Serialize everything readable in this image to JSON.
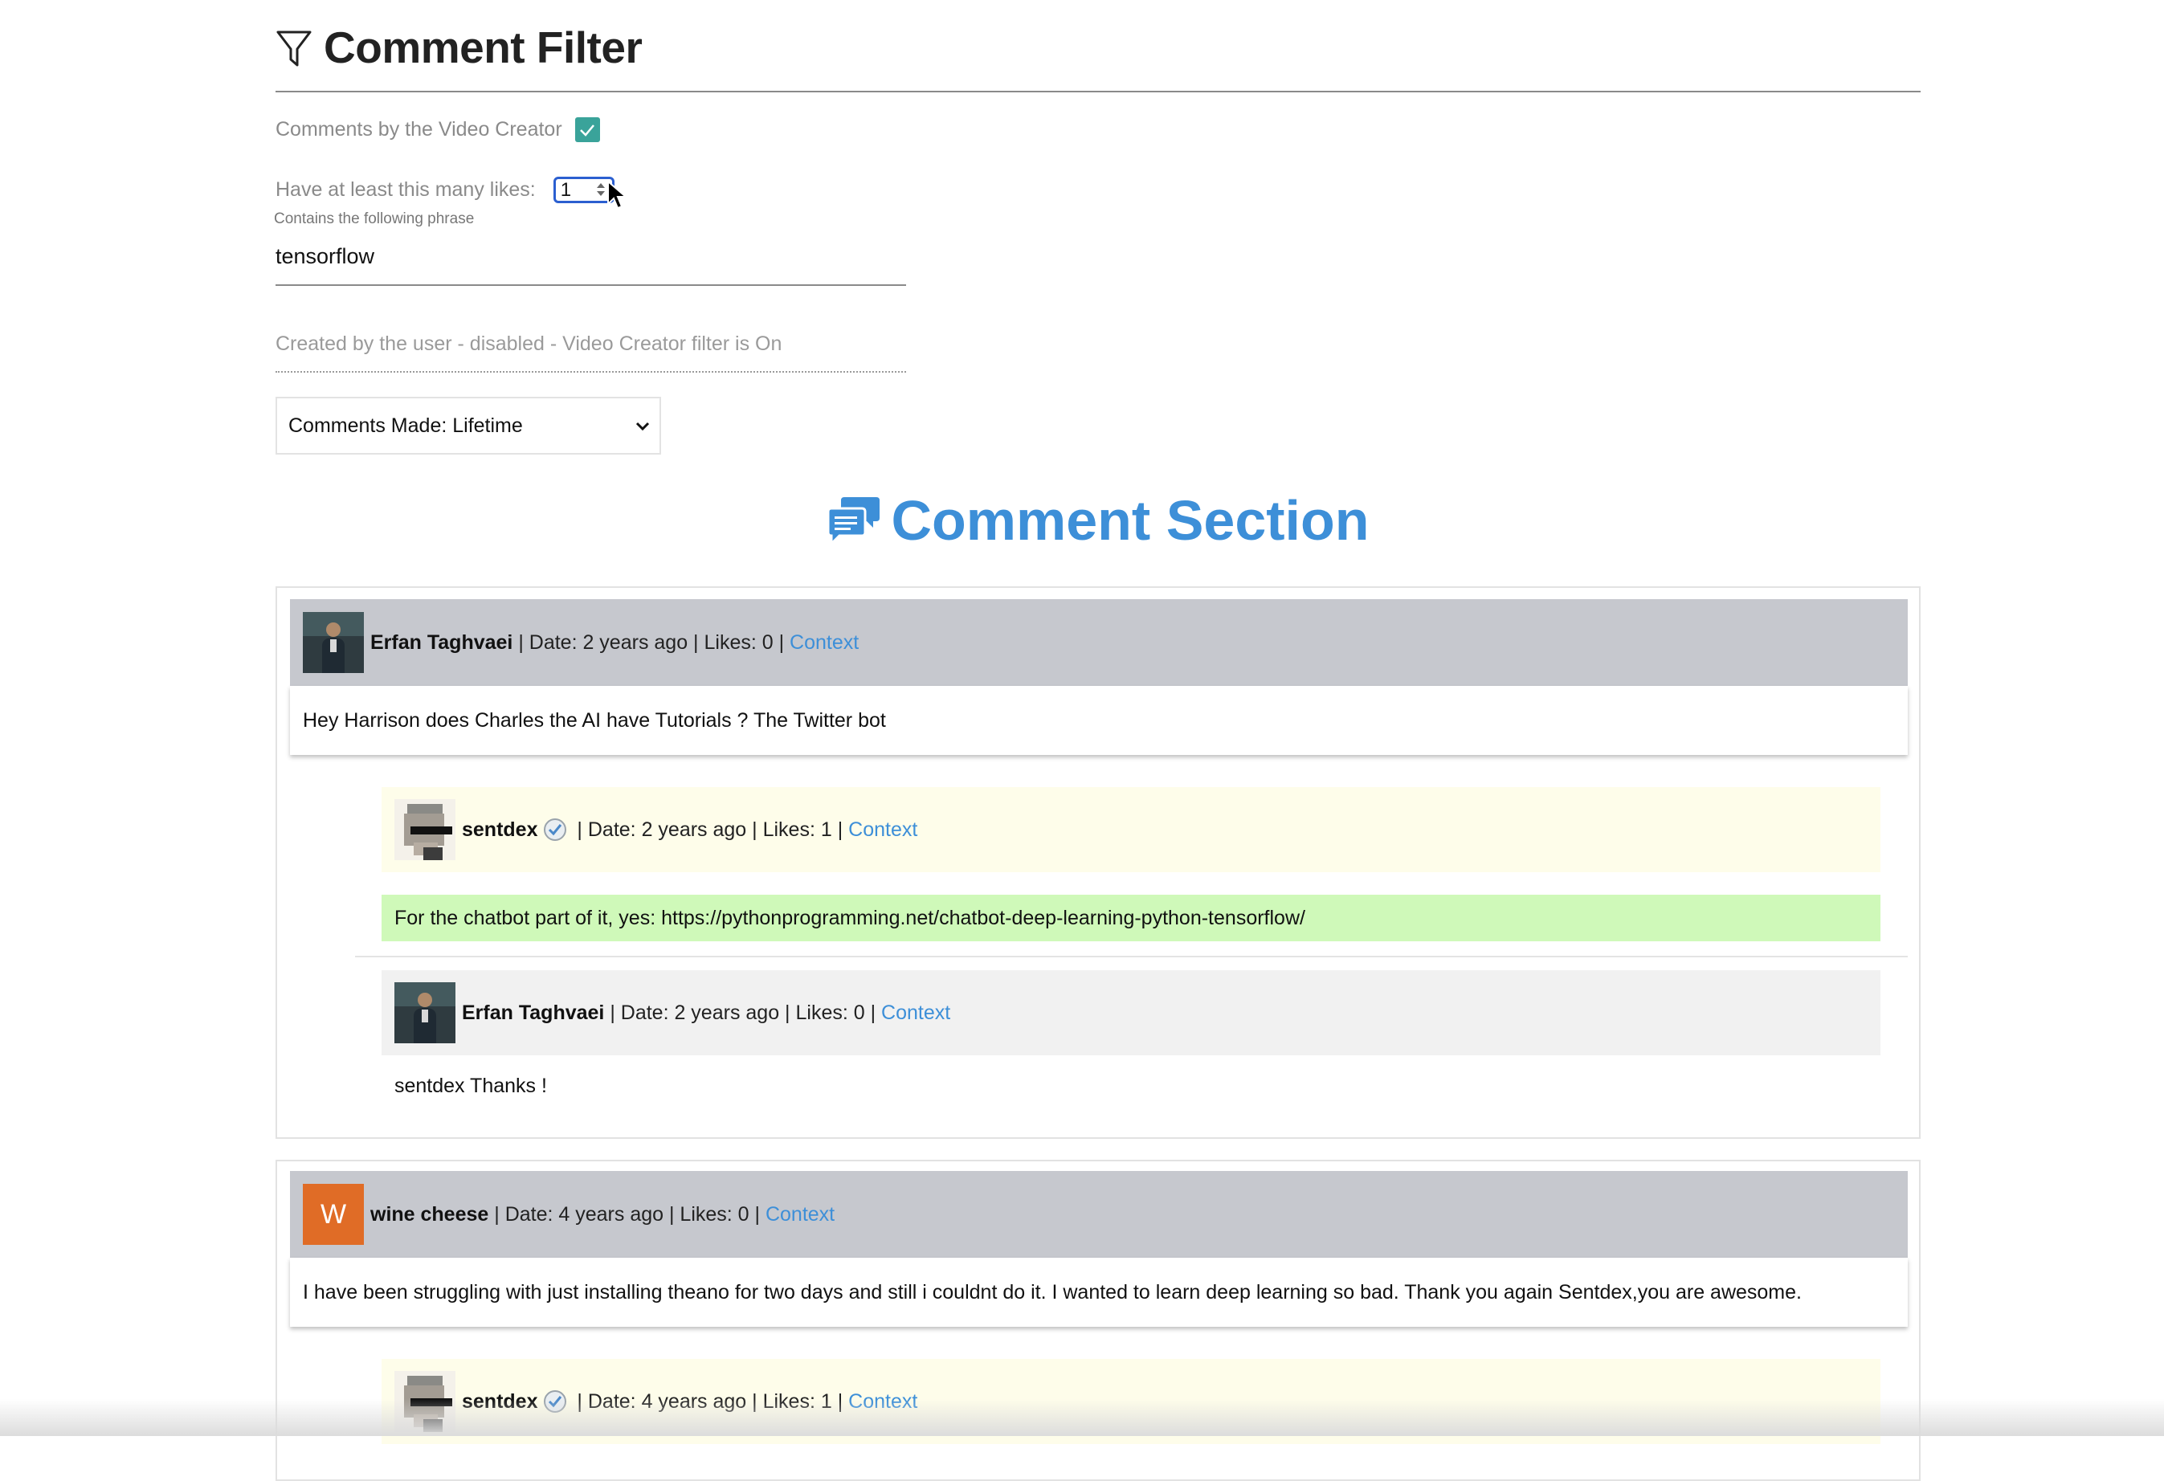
{
  "filter": {
    "title": "Comment Filter",
    "creator_label": "Comments by the Video Creator",
    "creator_checked": true,
    "likes_label": "Have at least this many likes:",
    "likes_value": "1",
    "phrase_caption": "Contains the following phrase",
    "phrase_value": "tensorflow",
    "user_placeholder": "Created by the user - disabled - Video Creator filter is On",
    "period_selected": "Comments Made: Lifetime"
  },
  "comment_section": {
    "title": "Comment Section"
  },
  "threads": [
    {
      "top": {
        "author": "Erfan Taghvaei",
        "meta": " | Date: 2 years ago | Likes: 0 | ",
        "context": "Context",
        "text": "Hey Harrison does Charles the AI have Tutorials ? The Twitter bot"
      },
      "replies": [
        {
          "author": "sentdex",
          "verified": true,
          "meta": " | Date: 2 years ago | Likes: 1 | ",
          "context": "Context",
          "text": "For the chatbot part of it, yes: https://pythonprogramming.net/chatbot-deep-learning-python-tensorflow/"
        },
        {
          "author": "Erfan Taghvaei",
          "meta": " | Date: 2 years ago | Likes: 0 | ",
          "context": "Context",
          "text": "sentdex Thanks !"
        }
      ]
    },
    {
      "top": {
        "author": "wine cheese",
        "avatar_letter": "W",
        "meta": " | Date: 4 years ago | Likes: 0 | ",
        "context": "Context",
        "text": "I have been struggling with just installing theano for two days and still i couldnt do it. I wanted to learn deep learning so bad. Thank you again Sentdex,you are awesome."
      },
      "replies": [
        {
          "author": "sentdex",
          "verified": true,
          "meta": " | Date: 4 years ago | Likes: 1 | ",
          "context": "Context"
        }
      ]
    }
  ],
  "colors": {
    "accent_blue": "#3d8fd8",
    "checkbox_teal": "#3aa39a",
    "top_header_grey": "#c6c8ce",
    "creator_reply_yellow": "#fefdea",
    "match_highlight_green": "#cff9b9",
    "reply_header_grey": "#f1f1f1",
    "avatar_orange": "#e06c26"
  }
}
